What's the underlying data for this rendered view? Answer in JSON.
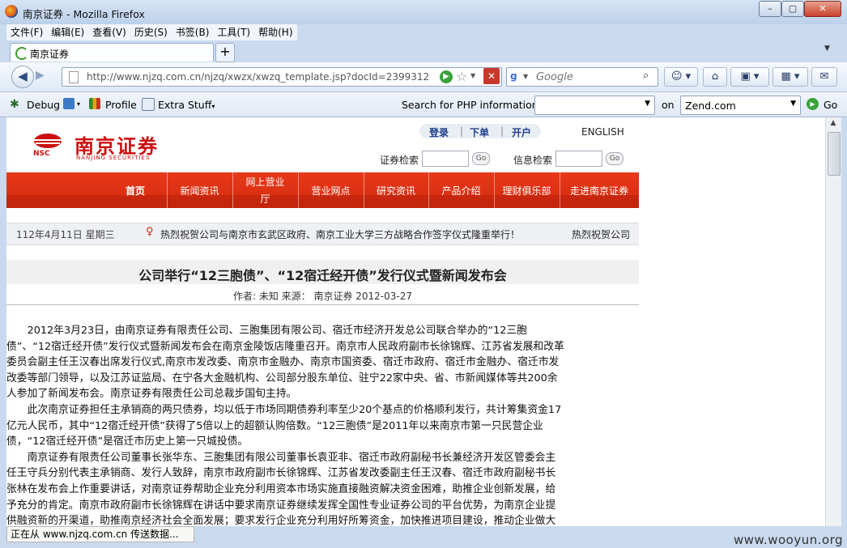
{
  "window": {
    "title": "南京证券 - Mozilla Firefox",
    "buttons": {
      "minimize": "–",
      "maximize": "▢",
      "close": "✕"
    }
  },
  "menu": [
    "文件(F)",
    "编辑(E)",
    "查看(V)",
    "历史(S)",
    "书签(B)",
    "工具(T)",
    "帮助(H)"
  ],
  "tabs": {
    "active": "南京证券",
    "new_tab": "+"
  },
  "nav": {
    "url": "http://www.njzq.com.cn/njzq/xwzx/xwzq_template.jsp?docId=2399312",
    "search_placeholder": "Google"
  },
  "toolbar2": {
    "debug": "Debug",
    "profile": "Profile",
    "extra": "Extra Stuff",
    "php_label": "Search for PHP information:",
    "php_value": "",
    "on": "on",
    "site_value": "Zend.com",
    "go": "Go"
  },
  "site": {
    "logo_cn": "南京证券",
    "logo_en": "NANJING SECURITIES",
    "logo_abbr": "NSC",
    "toplinks": [
      "登录",
      "下单",
      "开户"
    ],
    "english": "ENGLISH",
    "stock_search": "证券检索",
    "info_search": "信息检索",
    "go_label": "Go",
    "nav": [
      {
        "l1": "首页",
        "l2": ""
      },
      {
        "l1": "新闻资讯",
        "l2": ""
      },
      {
        "l1": "网上营业",
        "l2": "厅"
      },
      {
        "l1": "营业网点",
        "l2": ""
      },
      {
        "l1": "研究资讯",
        "l2": ""
      },
      {
        "l1": "产品介绍",
        "l2": ""
      },
      {
        "l1": "理财俱乐部",
        "l2": ""
      },
      {
        "l1": "走进南京证券",
        "l2": ""
      }
    ],
    "date": "112年4月11日 星期三",
    "ticker": "热烈祝贺公司与南京市玄武区政府、南京工业大学三方战略合作签字仪式隆重举行！",
    "ticker2": "热烈祝贺公司"
  },
  "article": {
    "title": "公司举行“12三胞债”、“12宿迁经开债”发行仪式暨新闻发布会",
    "meta": "作者: 未知  来源：  南京证券    2012-03-27",
    "p1": "2012年3月23日，由南京证券有限责任公司、三胞集团有限公司、宿迁市经济开发总公司联合举办的“12三胞债”、“12宿迁经开债”发行仪式暨新闻发布会在南京金陵饭店隆重召开。南京市人民政府副市长徐锦辉、江苏省发展和改革委员会副主任王汉春出席发行仪式,南京市发改委、南京市金融办、南京市国资委、宿迁市政府、宿迁市金融办、宿迁市发改委等部门领导，以及江苏证监局、在宁各大金融机构、公司部分股东单位、驻宁22家中央、省、市新闻媒体等共200余人参加了新闻发布会。南京证券有限责任公司总裁步国旬主持。",
    "p2": "此次南京证券担任主承销商的两只债券，均以低于市场同期债券利率至少20个基点的价格顺利发行，共计筹集资金17亿元人民币，其中“12宿迁经开债”获得了5倍以上的超额认购倍数。“12三胞债”是2011年以来南京市第一只民营企业债，“12宿迁经开债”是宿迁市历史上第一只城投债。",
    "p3": "南京证券有限责任公司董事长张华东、三胞集团有限公司董事长袁亚非、宿迁市政府副秘书长兼经济开发区管委会主任王守兵分别代表主承销商、发行人致辞，南京市政府副市长徐锦辉、江苏省发改委副主任王汉春、宿迁市政府副秘书长张林在发布会上作重要讲话，对南京证券帮助企业充分利用资本市场实施直接融资解决资金困难，助推企业创新发展，给予充分的肯定。南京市政府副市长徐锦辉在讲话中要求南京证券继续发挥全国性专业证券公司的平台优势，为南京企业提供融资新的开渠道，助推南京经济社会全面发展；要求发行企业充分利用好所筹资金，加快推进项目建设，推动企业做大做强，带动地方经济社会发展，促进企业自身发展；要求全市企业抢抓债券市场发展机遇"
  },
  "status": "正在从 www.njzq.com.cn 传送数据...",
  "watermark": "www.wooyun.org"
}
